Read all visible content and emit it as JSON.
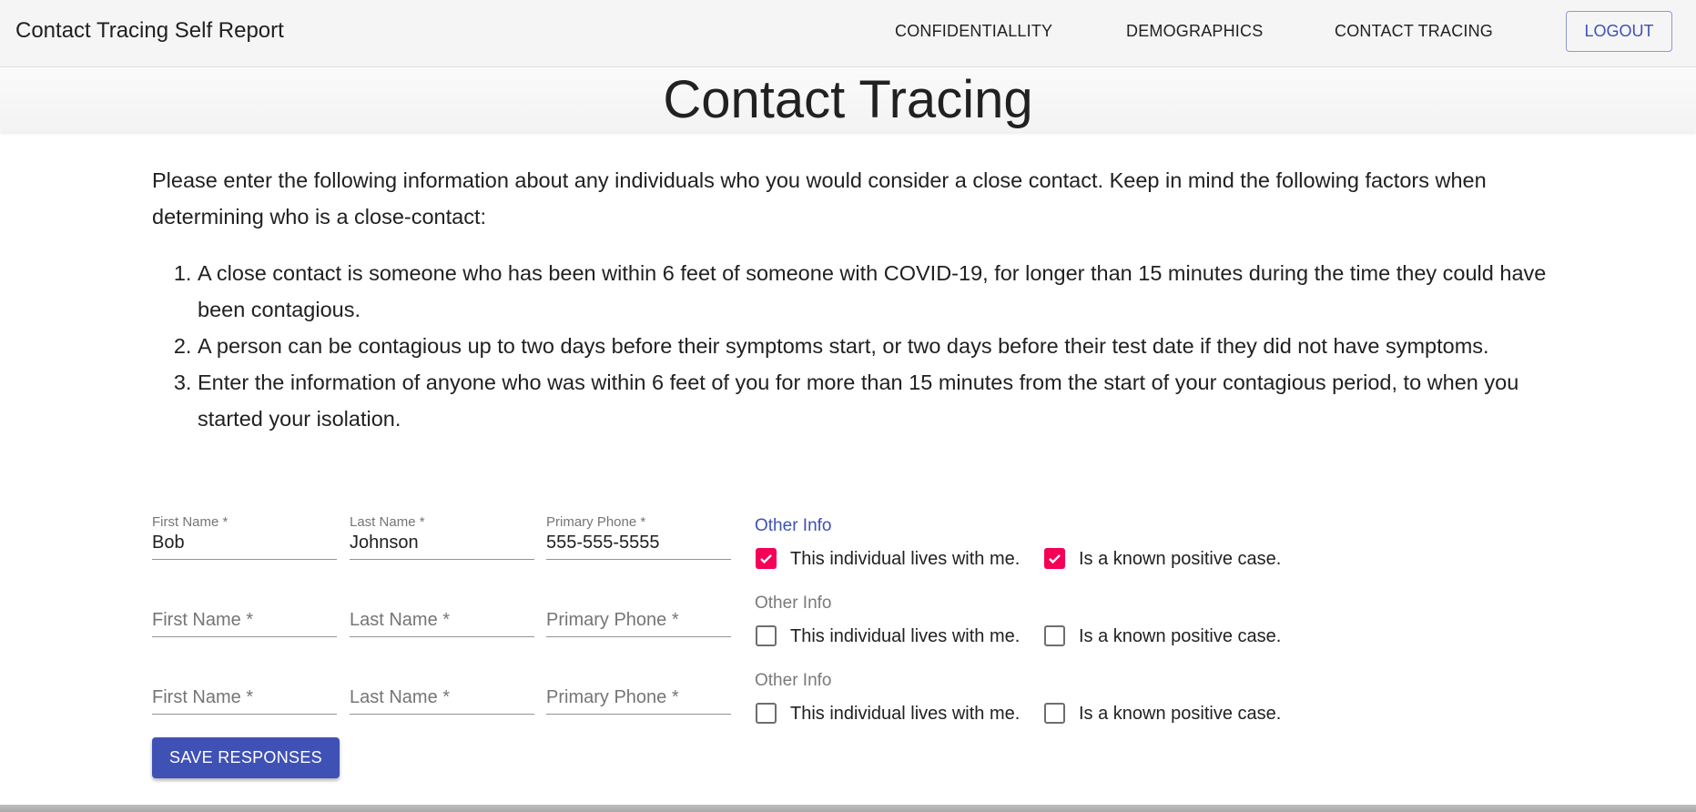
{
  "appbar": {
    "title": "Contact Tracing Self Report",
    "nav": [
      {
        "label": "CONFIDENTIALLITY"
      },
      {
        "label": "DEMOGRAPHICS"
      },
      {
        "label": "CONTACT TRACING"
      }
    ],
    "logout_label": "LOGOUT"
  },
  "page": {
    "title": "Contact Tracing",
    "intro": "Please enter the following information about any individuals who you would consider a close contact. Keep in mind the following factors when determining who is a close-contact:",
    "factors": [
      "A close contact is someone who has been within 6 feet of someone with COVID-19, for longer than 15 minutes during the time they could have been contagious.",
      "A person can be contagious up to two days before their symptoms start, or two days before their test date if they did not have symptoms.",
      "Enter the information of anyone who was within 6 feet of you for more than 15 minutes from the start of your contagious period, to when you started your isolation."
    ]
  },
  "form": {
    "labels": {
      "first_name": "First Name *",
      "last_name": "Last Name *",
      "phone": "Primary Phone *",
      "other_info": "Other Info",
      "lives_with": "This individual lives with me.",
      "known_positive": "Is a known positive case."
    },
    "contacts": [
      {
        "first_name": "Bob",
        "last_name": "Johnson",
        "phone": "555-555-5555",
        "lives_with": true,
        "known_positive": true
      },
      {
        "first_name": "",
        "last_name": "",
        "phone": "",
        "lives_with": false,
        "known_positive": false
      },
      {
        "first_name": "",
        "last_name": "",
        "phone": "",
        "lives_with": false,
        "known_positive": false
      }
    ],
    "save_label": "SAVE RESPONSES"
  },
  "colors": {
    "primary": "#3f51b5",
    "checkbox_checked": "#f50057",
    "appbar_bg": "#f5f5f5"
  }
}
